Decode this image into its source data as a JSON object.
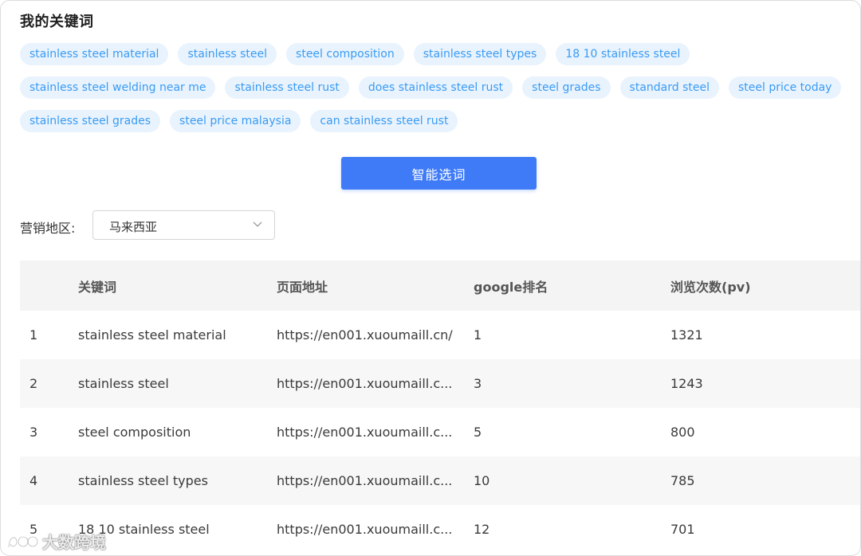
{
  "section": {
    "title": "我的关键词"
  },
  "tag_rows": [
    [
      "stainless steel material",
      "stainless steel",
      "steel composition",
      "stainless steel types",
      "18 10 stainless steel"
    ],
    [
      "stainless steel welding near me",
      "stainless steel rust",
      "does stainless steel rust",
      "steel grades",
      "standard steel",
      "steel price today"
    ],
    [
      "stainless steel grades",
      "steel price malaysia",
      "can stainless steel rust"
    ]
  ],
  "smart_button": {
    "label": "智能选词"
  },
  "region": {
    "label": "营销地区:",
    "selected": "马来西亚",
    "icon": "chevron-down-icon"
  },
  "table": {
    "headers": [
      "",
      "关键词",
      "页面地址",
      "google排名",
      "浏览次数(pv)"
    ],
    "rows": [
      [
        "1",
        "stainless steel material",
        "https://en001.xuoumaill.cn/",
        "1",
        "1321"
      ],
      [
        "2",
        "stainless steel",
        "https://en001.xuoumaill.c...",
        "3",
        "1243"
      ],
      [
        "3",
        "steel composition",
        "https://en001.xuoumaill.c...",
        "5",
        "800"
      ],
      [
        "4",
        "stainless steel types",
        "https://en001.xuoumaill.c...",
        "10",
        "785"
      ],
      [
        "5",
        "18 10 stainless steel",
        "https://en001.xuoumaill.c...",
        "12",
        "701"
      ]
    ]
  },
  "watermark": {
    "text": "大数跨境",
    "icon": "brand-logo-icon"
  },
  "colors": {
    "tag_bg": "#e9f3fd",
    "tag_text": "#3a9bf3",
    "primary_button": "#3f7bf7",
    "table_header_bg": "#f4f4f4",
    "table_stripe_bg": "#f7f7f7"
  }
}
